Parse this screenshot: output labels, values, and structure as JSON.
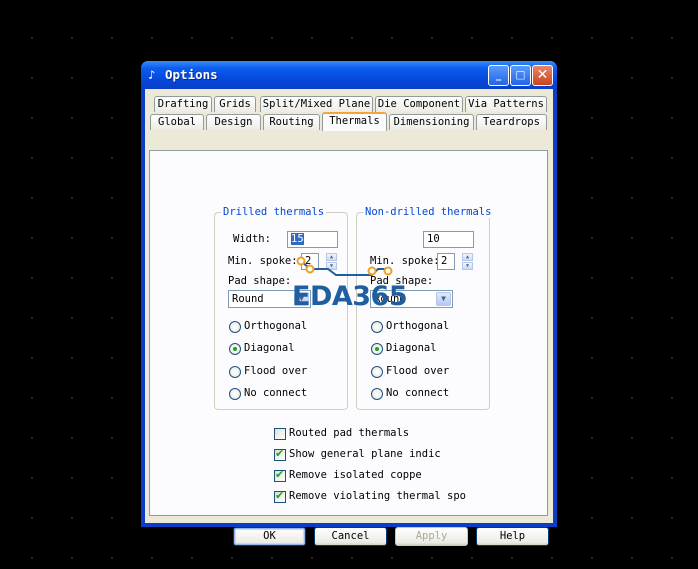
{
  "window": {
    "title": "Options",
    "app_icon": "options-app-icon",
    "controls": {
      "minimize": "_",
      "maximize": "□",
      "close": "✕"
    }
  },
  "tabs": {
    "back_row": [
      "Drafting",
      "Grids",
      "Split/Mixed Plane",
      "Die Component",
      "Via Patterns"
    ],
    "front_row": [
      "Global",
      "Design",
      "Routing",
      "Thermals",
      "Dimensioning",
      "Teardrops"
    ],
    "active": "Thermals"
  },
  "drilled": {
    "legend": "Drilled thermals",
    "width_label": "Width:",
    "width_value": "15",
    "spoke_label": "Min. spoke:",
    "spoke_value": "2",
    "pad_label": "Pad shape:",
    "pad_value": "Round",
    "options": [
      "Orthogonal",
      "Diagonal",
      "Flood over",
      "No connect"
    ],
    "selected": "Diagonal"
  },
  "nondrilled": {
    "legend": "Non-drilled thermals",
    "width_value": "10",
    "spoke_label": "Min. spoke:",
    "spoke_value": "2",
    "pad_label": "Pad shape:",
    "pad_value": "Round",
    "options": [
      "Orthogonal",
      "Diagonal",
      "Flood over",
      "No connect"
    ],
    "selected": "Diagonal"
  },
  "checkboxes": [
    {
      "label": "Routed pad thermals",
      "checked": false
    },
    {
      "label": "Show general plane indic",
      "checked": true
    },
    {
      "label": "Remove isolated coppe",
      "checked": true
    },
    {
      "label": "Remove violating thermal spo",
      "checked": true
    }
  ],
  "buttons": {
    "ok": "OK",
    "cancel": "Cancel",
    "apply": "Apply",
    "help": "Help"
  },
  "watermark": "EDA365",
  "colors": {
    "titlebar": "#0a3fc4",
    "legend": "#0046d5",
    "tab_highlight": "#f3a43a",
    "check": "#21a121",
    "watermark": "#1f5fa0",
    "logo_accent": "#f0a020"
  }
}
